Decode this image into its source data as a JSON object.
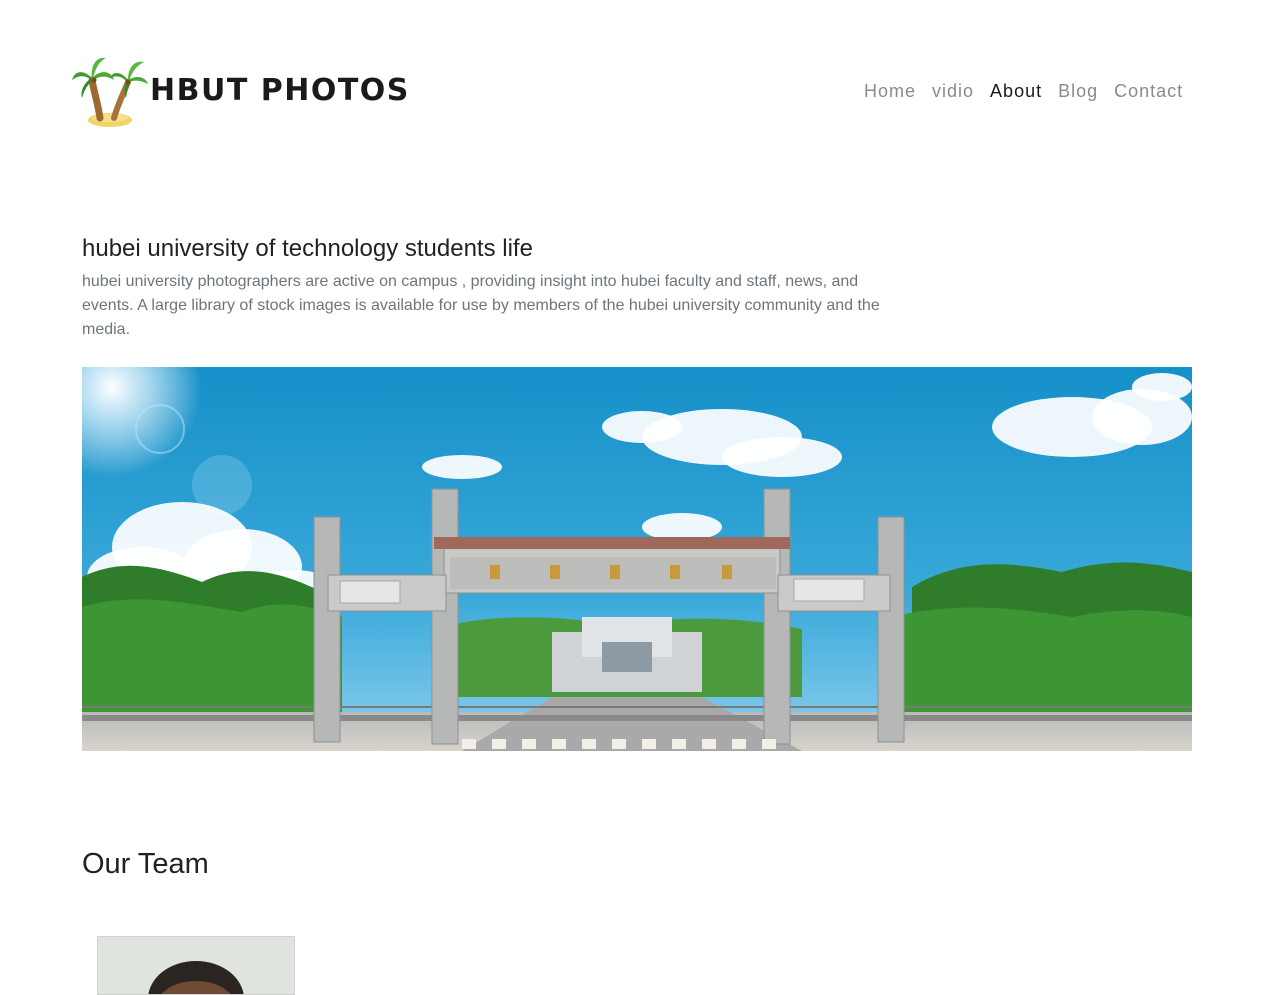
{
  "header": {
    "brand": "HBUT PHOTOS",
    "logo_icon": "palm-tree-icon",
    "nav": [
      {
        "label": "Home",
        "active": false
      },
      {
        "label": "vidio",
        "active": false
      },
      {
        "label": "About",
        "active": true
      },
      {
        "label": "Blog",
        "active": false
      },
      {
        "label": "Contact",
        "active": false
      }
    ]
  },
  "intro": {
    "title": "hubei university of technology students life",
    "text": "hubei university photographers are active on campus , providing insight into hubei faculty and staff, news, and events. A large library of stock images is available for use by members of the hubei university community and the media."
  },
  "banner": {
    "image": "campus-gate-photo"
  },
  "team": {
    "title": "Our Team",
    "members": [
      {
        "photo": "team-member-photo"
      }
    ]
  },
  "colors": {
    "text_dark": "#1a1a1a",
    "nav_inactive": "#8a8a8a",
    "body_muted": "#6c757d",
    "sky": "#1e9bd0"
  }
}
